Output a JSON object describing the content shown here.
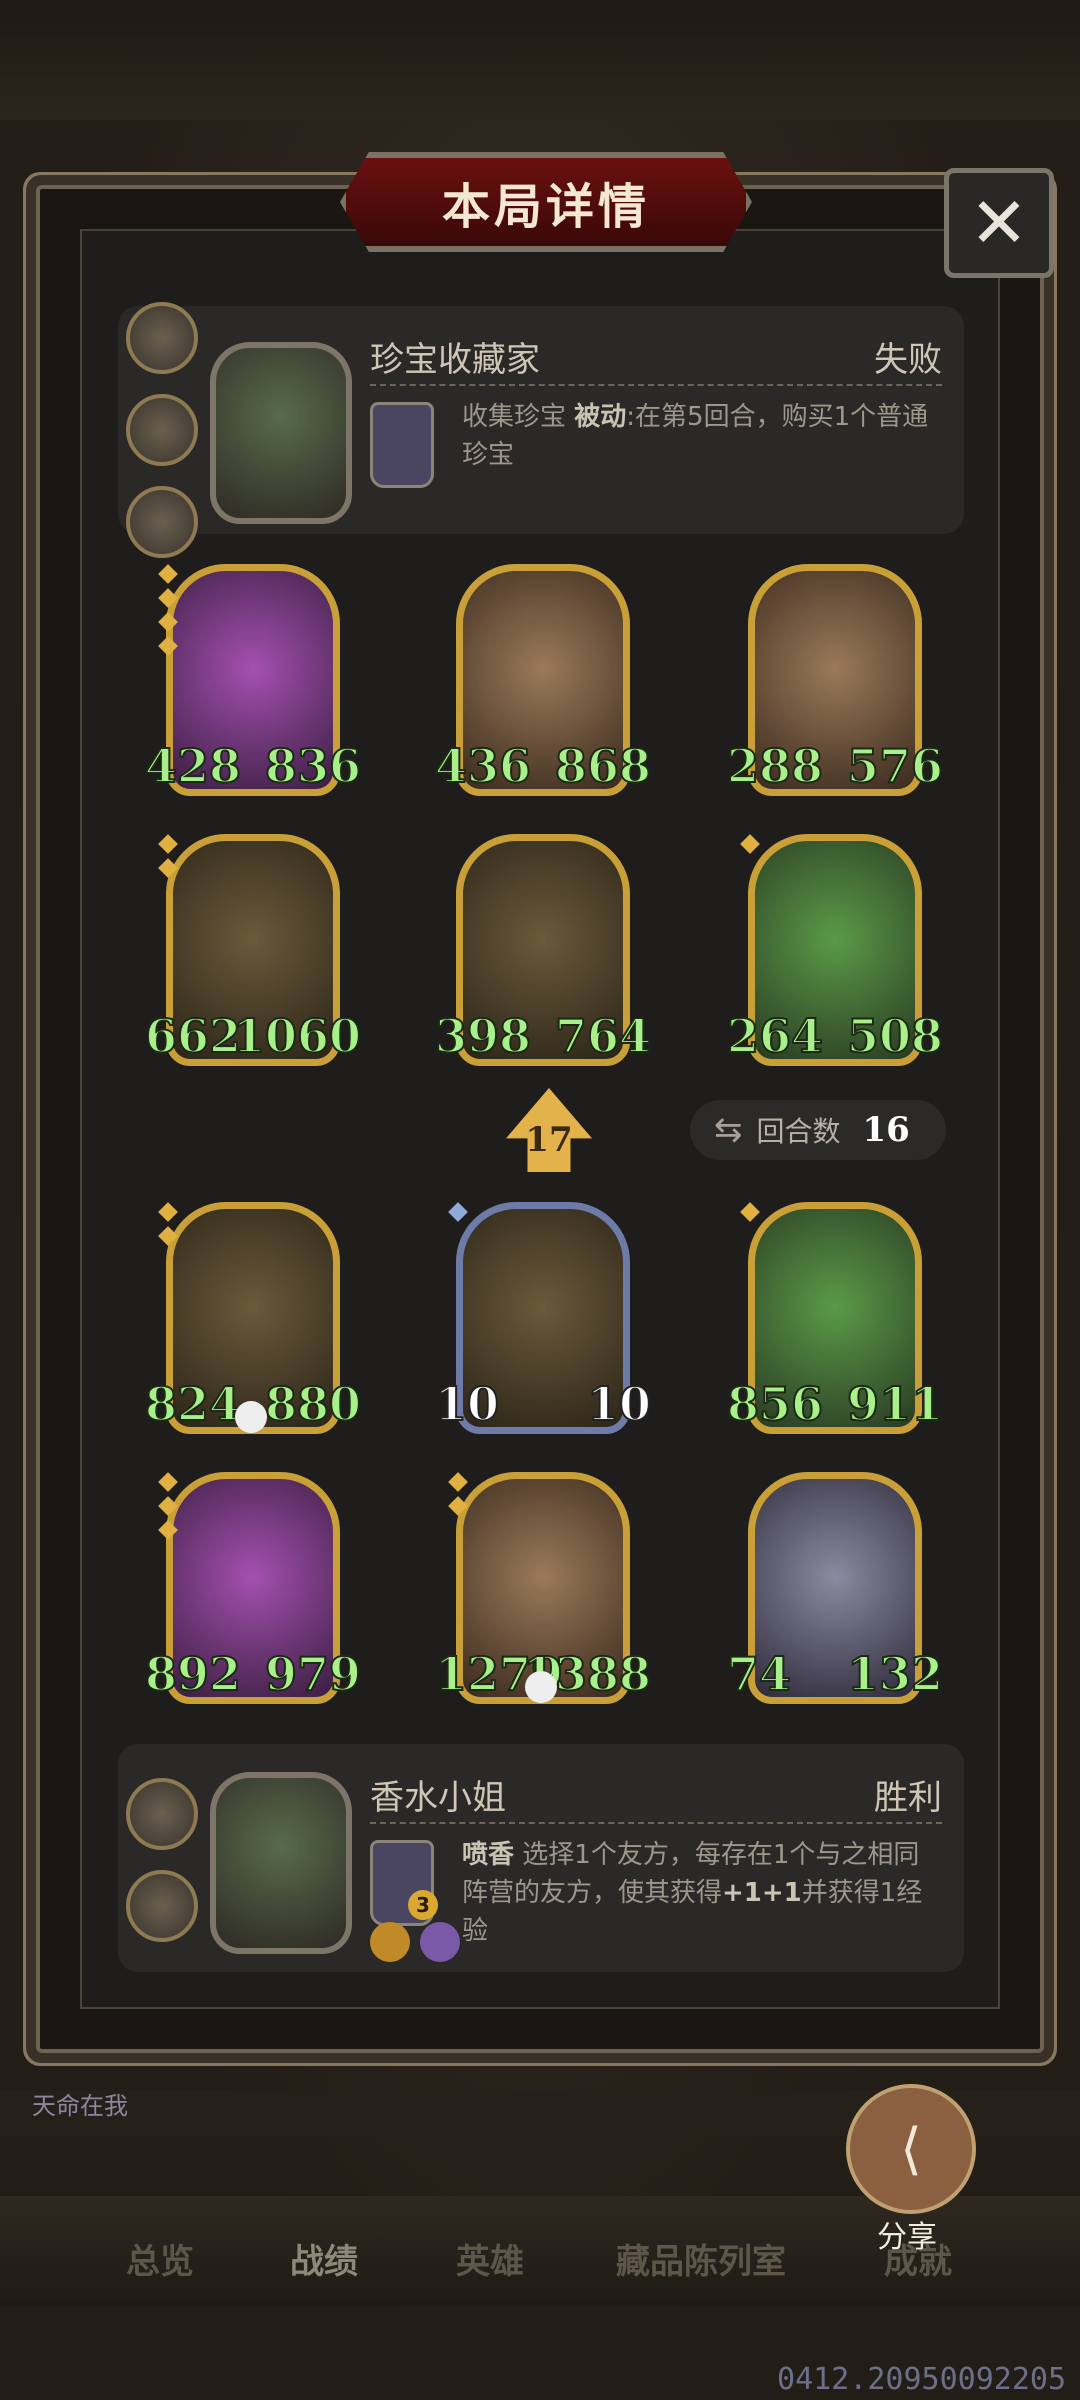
{
  "title": "本局详情",
  "close_icon": "close-icon",
  "opponent": {
    "name": "珍宝收藏家",
    "result": "失败",
    "skill_name": "收集珍宝",
    "skill_type": "被动",
    "skill_desc": ":在第5回合，购买1个普通珍宝"
  },
  "player": {
    "name": "香水小姐",
    "result": "胜利",
    "skill_name": "喷香",
    "skill_desc": "选择1个友方，每存在1个与之相同阵营的友方，使其获得",
    "skill_bold": "+1+1",
    "skill_desc2": "并获得1经验",
    "skill_level": "3"
  },
  "opponent_board": [
    {
      "atk": "428",
      "hp": "836"
    },
    {
      "atk": "436",
      "hp": "868"
    },
    {
      "atk": "288",
      "hp": "576"
    },
    {
      "atk": "662",
      "hp": "1060"
    },
    {
      "atk": "398",
      "hp": "764"
    },
    {
      "atk": "264",
      "hp": "508"
    }
  ],
  "player_board": [
    {
      "atk": "824",
      "hp": "880"
    },
    {
      "atk": "10",
      "hp": "10"
    },
    {
      "atk": "856",
      "hp": "911"
    },
    {
      "atk": "892",
      "hp": "979"
    },
    {
      "atk": "1279",
      "hp": "1388"
    },
    {
      "atk": "74",
      "hp": "132"
    }
  ],
  "level": "17",
  "rounds": {
    "label": "回合数",
    "value": "16"
  },
  "share": {
    "label": "分享"
  },
  "nav": {
    "items": [
      "总览",
      "战绩",
      "英雄",
      "藏品陈列室",
      "成就"
    ],
    "active": "战绩"
  },
  "chat_preview": "天命在我",
  "version": "0412.20950092205"
}
